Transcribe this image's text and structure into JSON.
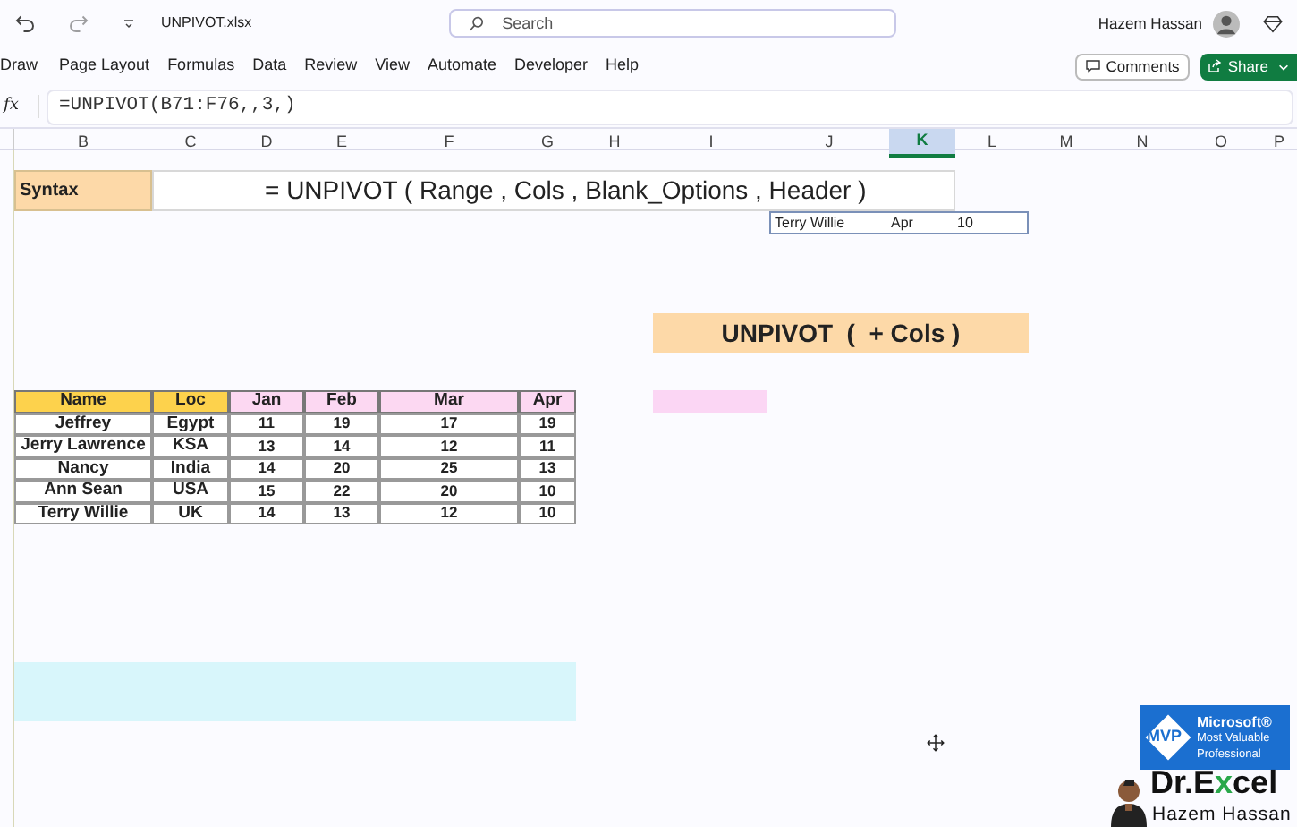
{
  "title_bar": {
    "file_name": "UNPIVOT.xlsx",
    "search": {
      "placeholder": "Search"
    },
    "user_name": "Hazem Hassan"
  },
  "ribbon": {
    "tabs": [
      {
        "label": "Draw"
      },
      {
        "label": "Page Layout"
      },
      {
        "label": "Formulas"
      },
      {
        "label": "Data"
      },
      {
        "label": "Review"
      },
      {
        "label": "View"
      },
      {
        "label": "Automate"
      },
      {
        "label": "Developer"
      },
      {
        "label": "Help"
      }
    ],
    "comments_button": "Comments",
    "share_button": "Share"
  },
  "formula_bar": {
    "fx": "fx",
    "formula": "=UNPIVOT(B71:F76,,3,)"
  },
  "columns": [
    {
      "label": "B",
      "selected": false
    },
    {
      "label": "C",
      "selected": false
    },
    {
      "label": "D",
      "selected": false
    },
    {
      "label": "E",
      "selected": false
    },
    {
      "label": "F",
      "selected": false
    },
    {
      "label": "G",
      "selected": false
    },
    {
      "label": "H",
      "selected": false
    },
    {
      "label": "I",
      "selected": false
    },
    {
      "label": "J",
      "selected": false
    },
    {
      "label": "K",
      "selected": true
    },
    {
      "label": "L",
      "selected": false
    },
    {
      "label": "M",
      "selected": false
    },
    {
      "label": "N",
      "selected": false
    },
    {
      "label": "O",
      "selected": false
    },
    {
      "label": "P",
      "selected": false
    }
  ],
  "syntax": {
    "label": "Syntax",
    "formula": "= UNPIVOT ( Range , Cols , Blank_Options , Header )"
  },
  "result_row": [
    "Terry Willie",
    "Apr",
    "10"
  ],
  "banner": "UNPIVOT  (  + Cols )",
  "table": {
    "columns": [
      "Name",
      "Loc",
      "Jan",
      "Feb",
      "Mar",
      "Apr"
    ],
    "rows": [
      [
        "Jeffrey",
        "Egypt",
        "11",
        "19",
        "17",
        "19"
      ],
      [
        "Jerry Lawrence",
        "KSA",
        "13",
        "14",
        "12",
        "11"
      ],
      [
        "Nancy",
        "India",
        "14",
        "20",
        "25",
        "13"
      ],
      [
        "Ann Sean",
        "USA",
        "15",
        "22",
        "20",
        "10"
      ],
      [
        "Terry Willie",
        "UK",
        "14",
        "13",
        "12",
        "10"
      ]
    ]
  },
  "mvp_badge": {
    "mark": "MVP",
    "brand": "Microsoft®",
    "line_1": "Most Valuable",
    "line_2": "Professional"
  },
  "signature": {
    "brand": "Dr.Excel",
    "name": "Hazem Hassan"
  }
}
